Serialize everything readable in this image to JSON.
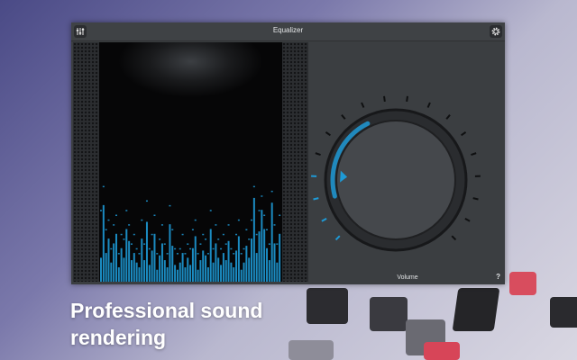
{
  "window": {
    "title": "Equalizer",
    "menu_icon": "equalizer-sliders-icon",
    "settings_icon": "gear-icon"
  },
  "spectrum": {
    "accent_color": "#1e9ad6",
    "levels": [
      0.1,
      0.32,
      0.12,
      0.18,
      0.08,
      0.16,
      0.2,
      0.06,
      0.14,
      0.1,
      0.22,
      0.17,
      0.09,
      0.12,
      0.08,
      0.06,
      0.18,
      0.09,
      0.25,
      0.07,
      0.13,
      0.2,
      0.05,
      0.11,
      0.16,
      0.09,
      0.06,
      0.24,
      0.15,
      0.07,
      0.05,
      0.08,
      0.12,
      0.06,
      0.1,
      0.07,
      0.14,
      0.19,
      0.05,
      0.09,
      0.13,
      0.11,
      0.06,
      0.22,
      0.08,
      0.16,
      0.1,
      0.07,
      0.12,
      0.09,
      0.17,
      0.08,
      0.06,
      0.13,
      0.19,
      0.05,
      0.08,
      0.15,
      0.1,
      0.18,
      0.35,
      0.12,
      0.21,
      0.3,
      0.22,
      0.14,
      0.09,
      0.33,
      0.16,
      0.08,
      0.2
    ],
    "peaks": [
      0.3,
      0.4,
      0.22,
      0.26,
      0.14,
      0.24,
      0.28,
      0.12,
      0.2,
      0.18,
      0.3,
      0.24,
      0.16,
      0.2,
      0.14,
      0.12,
      0.26,
      0.16,
      0.34,
      0.14,
      0.2,
      0.28,
      0.12,
      0.18,
      0.24,
      0.16,
      0.12,
      0.32,
      0.22,
      0.14,
      0.12,
      0.14,
      0.2,
      0.12,
      0.16,
      0.14,
      0.22,
      0.26,
      0.12,
      0.16,
      0.2,
      0.18,
      0.12,
      0.3,
      0.14,
      0.24,
      0.18,
      0.14,
      0.2,
      0.16,
      0.24,
      0.14,
      0.12,
      0.2,
      0.26,
      0.12,
      0.14,
      0.22,
      0.18,
      0.26,
      0.4,
      0.2,
      0.3,
      0.36,
      0.28,
      0.22,
      0.16,
      0.38,
      0.24,
      0.16,
      0.28
    ]
  },
  "volume": {
    "label": "Volume",
    "help_label": "?",
    "level": 0.18,
    "accent_color": "#1e9ad6"
  },
  "caption": {
    "line1": "Professional sound",
    "line2": "rendering"
  }
}
